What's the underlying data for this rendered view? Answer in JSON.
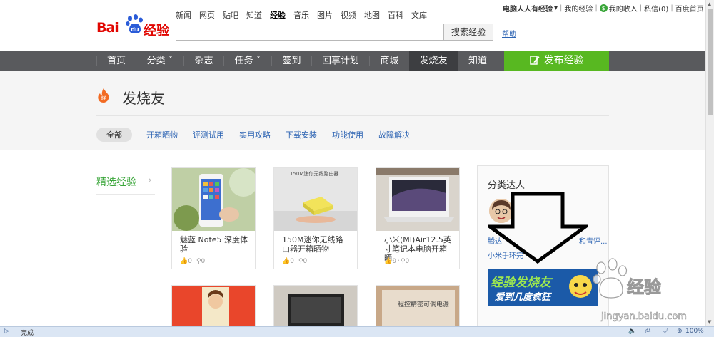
{
  "logo": {
    "bai": "Bai",
    "du": "du",
    "jingyan": "经验"
  },
  "topnav": [
    "新闻",
    "网页",
    "贴吧",
    "知道",
    "经验",
    "音乐",
    "图片",
    "视频",
    "地图",
    "百科",
    "文库"
  ],
  "search": {
    "button": "搜索经验",
    "help": "帮助"
  },
  "user_bar": {
    "username": "电脑人人有经验",
    "chevron": "▾",
    "my_exp": "我的经验",
    "income": "我的收入",
    "messages": "私信(0)",
    "home": "百度首页",
    "coin": "$"
  },
  "navbar": {
    "items": [
      {
        "label": "首页"
      },
      {
        "label": "分类 ˅"
      },
      {
        "label": "杂志"
      },
      {
        "label": "任务 ˅"
      },
      {
        "label": "签到"
      },
      {
        "label": "回享计划"
      },
      {
        "label": "商城"
      },
      {
        "label": "发烧友"
      },
      {
        "label": "知道"
      }
    ],
    "publish": "发布经验"
  },
  "title_area": {
    "fire_glyph": "烧",
    "title": "发烧友",
    "filters": [
      "全部",
      "开箱晒物",
      "评测试用",
      "实用攻略",
      "下载安装",
      "功能使用",
      "故障解决"
    ]
  },
  "content": {
    "left_category": "精选经验",
    "left_arrow": "›",
    "cards": [
      {
        "title": "魅蓝 Note5 深度体验",
        "likes": "0",
        "shares": "0"
      },
      {
        "title": "150M迷你无线路由器开箱晒物",
        "likes": "0",
        "shares": "0",
        "img_text": "150M迷你无线路由器"
      },
      {
        "title": "小米(MI)Air12.5英寸笔记本电脑开箱晒...",
        "likes": "0",
        "shares": "0"
      }
    ],
    "bottom_card_text": "程控精密可调电源",
    "side": {
      "title": "分类达人",
      "name1": "腾达",
      "name2": "和青评...",
      "sub": "小米手环完",
      "banner_line1": "经验发烧友",
      "banner_line2": "爱到几度疯狂"
    }
  },
  "watermark": {
    "text": "经验",
    "url": "jingyan.baidu.com"
  },
  "statusbar": {
    "status": "完成",
    "zoom": "100%"
  },
  "colors": {
    "nav_bg": "#595a5d",
    "publish_green": "#58b821",
    "link_blue": "#2d64b3",
    "brand_red": "#e10601"
  }
}
